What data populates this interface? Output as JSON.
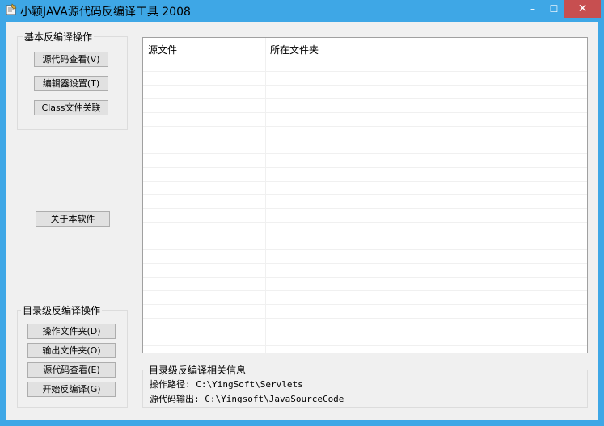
{
  "window": {
    "title": "小颖JAVA源代码反编译工具 2008"
  },
  "controls": {
    "minimize": "–",
    "maximize": "☐",
    "close": "✕"
  },
  "basic_group": {
    "label": "基本反编译操作",
    "buttons": [
      "源代码查看(V)",
      "编辑器设置(T)",
      "Class文件关联"
    ]
  },
  "about_button": "关于本软件",
  "dir_group": {
    "label": "目录级反编译操作",
    "buttons": [
      "操作文件夹(D)",
      "输出文件夹(O)",
      "源代码查看(E)",
      "开始反编译(G)"
    ]
  },
  "listview": {
    "columns": [
      "源文件",
      "所在文件夹"
    ]
  },
  "info_group": {
    "label": "目录级反编译相关信息",
    "lines": [
      "操作路径: C:\\YingSoft\\Servlets",
      "源代码输出: C:\\Yingsoft\\JavaSourceCode"
    ]
  }
}
